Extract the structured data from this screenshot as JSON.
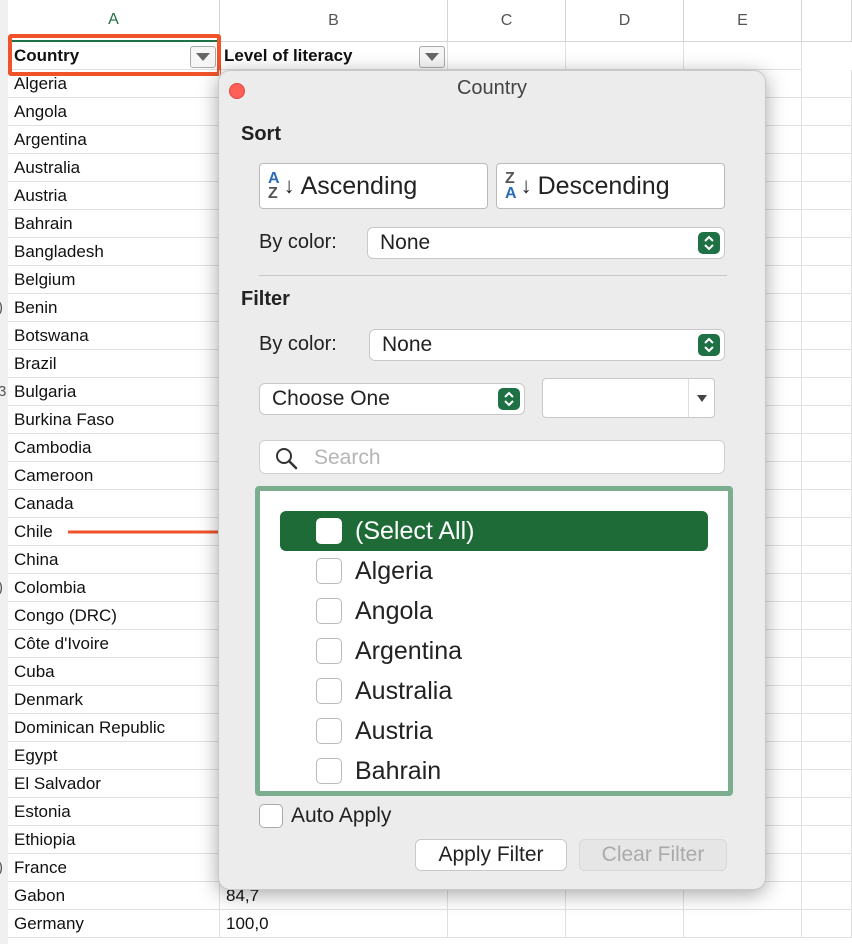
{
  "columns": [
    "A",
    "B",
    "C",
    "D",
    "E"
  ],
  "header_row": {
    "country": "Country",
    "literacy": "Level of literacy"
  },
  "row_number_fragments": [
    "",
    "",
    "",
    "",
    "",
    "",
    "",
    "",
    ")",
    "",
    "",
    "3",
    "",
    "",
    "",
    "",
    "",
    "",
    ")",
    "",
    "",
    "",
    "",
    "",
    "",
    "",
    "",
    "",
    ")",
    "",
    ""
  ],
  "countries": [
    "Algeria",
    "Angola",
    "Argentina",
    "Australia",
    "Austria",
    "Bahrain",
    "Bangladesh",
    "Belgium",
    "Benin",
    "Botswana",
    "Brazil",
    "Bulgaria",
    "Burkina Faso",
    "Cambodia",
    "Cameroon",
    "Canada",
    "Chile",
    "China",
    "Colombia",
    "Congo (DRC)",
    "Côte d'Ivoire",
    "Cuba",
    "Denmark",
    "Dominican Republic",
    "Egypt",
    "El Salvador",
    "Estonia",
    "Ethiopia",
    "France",
    "Gabon",
    "Germany"
  ],
  "literacy_visible": {
    "gabon": "84,7",
    "germany": "100,0"
  },
  "popup": {
    "title": "Country",
    "sort_title": "Sort",
    "ascending": "Ascending",
    "descending": "Descending",
    "sort_by_color_label": "By color:",
    "sort_by_color_value": "None",
    "filter_title": "Filter",
    "filter_by_color_label": "By color:",
    "filter_by_color_value": "None",
    "condition_value": "Choose One",
    "search_placeholder": "Search",
    "list_items": [
      "(Select All)",
      "Algeria",
      "Angola",
      "Argentina",
      "Australia",
      "Austria",
      "Bahrain"
    ],
    "auto_apply": "Auto Apply",
    "apply_filter": "Apply Filter",
    "clear_filter": "Clear Filter"
  },
  "colors": {
    "accent": "#1e7145",
    "highlight": "#f0532a",
    "list_border": "#7aae8f"
  }
}
